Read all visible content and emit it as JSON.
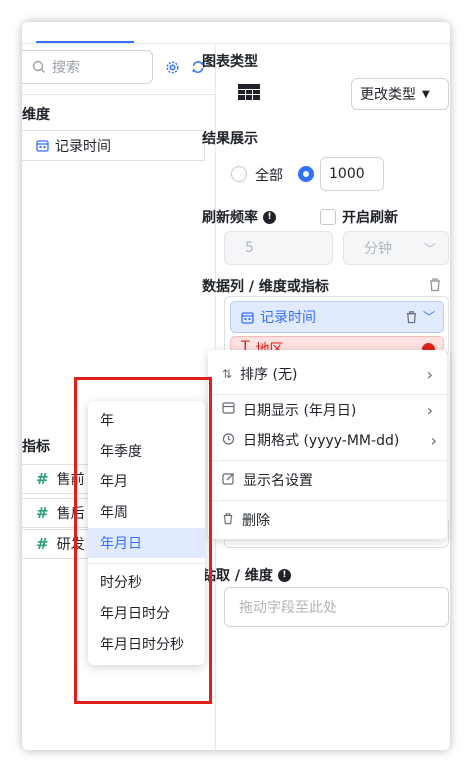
{
  "left_panel": {
    "search_placeholder": "搜索",
    "dimension_title": "维度",
    "dimension_field": "记录时间",
    "metric_title": "指标",
    "metric_fields": [
      "售前",
      "售后",
      "研发"
    ]
  },
  "right_panel": {
    "chart_type_label": "图表类型",
    "change_type_label": "更改类型",
    "result_label": "结果展示",
    "result_all": "全部",
    "result_count": "1000",
    "refresh_label": "刷新频率",
    "refresh_enable": "开启刷新",
    "refresh_value": "5",
    "refresh_unit": "分钟",
    "columns_label": "数据列 / 维度或指标",
    "column_1": "记录时间",
    "column_2": "地区",
    "drill_label": "钻取 / 维度",
    "drill_placeholder": "拖动字段至此处"
  },
  "context_menu": {
    "sort": "排序 (无)",
    "date_display": "日期显示 (年月日)",
    "date_format": "日期格式 (yyyy-MM-dd)",
    "display_name": "显示名设置",
    "delete": "删除"
  },
  "date_submenu": {
    "group_1": [
      "年",
      "年季度",
      "年月",
      "年周",
      "年月日"
    ],
    "group_2": [
      "时分秒",
      "年月日时分",
      "年月日时分秒"
    ],
    "selected": "年月日"
  },
  "colors": {
    "accent": "#3370ff",
    "highlight_box": "#e0201c",
    "number_field": "#2aa37a",
    "selected_bg": "#e1eaff"
  }
}
